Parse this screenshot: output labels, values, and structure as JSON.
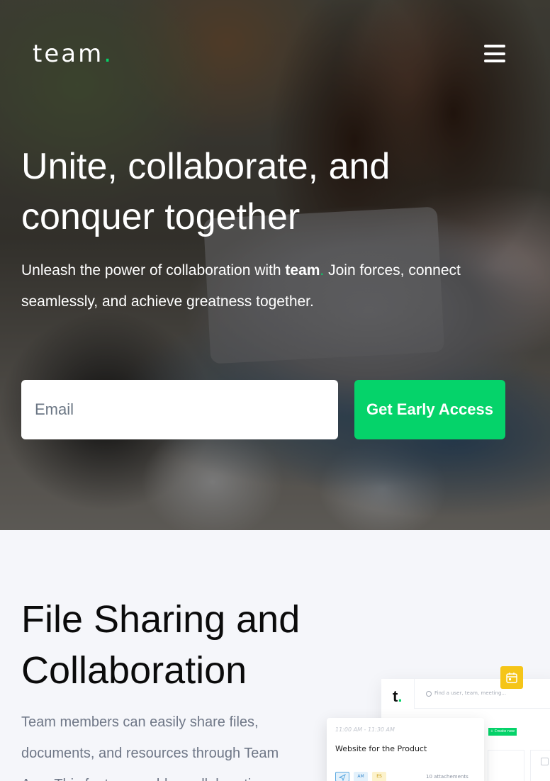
{
  "brand": {
    "name": "team",
    "dot": ".",
    "accent_color": "#05d36a"
  },
  "header": {
    "menu_icon": "hamburger-menu-icon"
  },
  "hero": {
    "title": "Unite, collaborate, and conquer together",
    "subtitle_prefix": "Unleash the power of collaboration with ",
    "subtitle_brand": "team",
    "subtitle_dot": ".",
    "subtitle_suffix": " Join forces, connect seamlessly, and achieve greatness together.",
    "email_placeholder": "Email",
    "cta_label": "Get Early Access"
  },
  "feature": {
    "title": "File Sharing and Collaboration",
    "text": "Team members can easily share files, documents, and resources through Team App. This feature enables collaboration"
  },
  "mockup": {
    "logo": "t",
    "logo_dot": ".",
    "search_placeholder": "Find a user, team, meeting...",
    "create_label": "+ Create new",
    "card_time": "11:00 AM - 11:30 AM",
    "card_title": "Website for the Product",
    "tag_1": "",
    "tag_2": "AM",
    "tag_3": "ES",
    "attachments": "10 attachements",
    "calendar_icon": "calendar-icon",
    "card_color": "#f5c518"
  }
}
